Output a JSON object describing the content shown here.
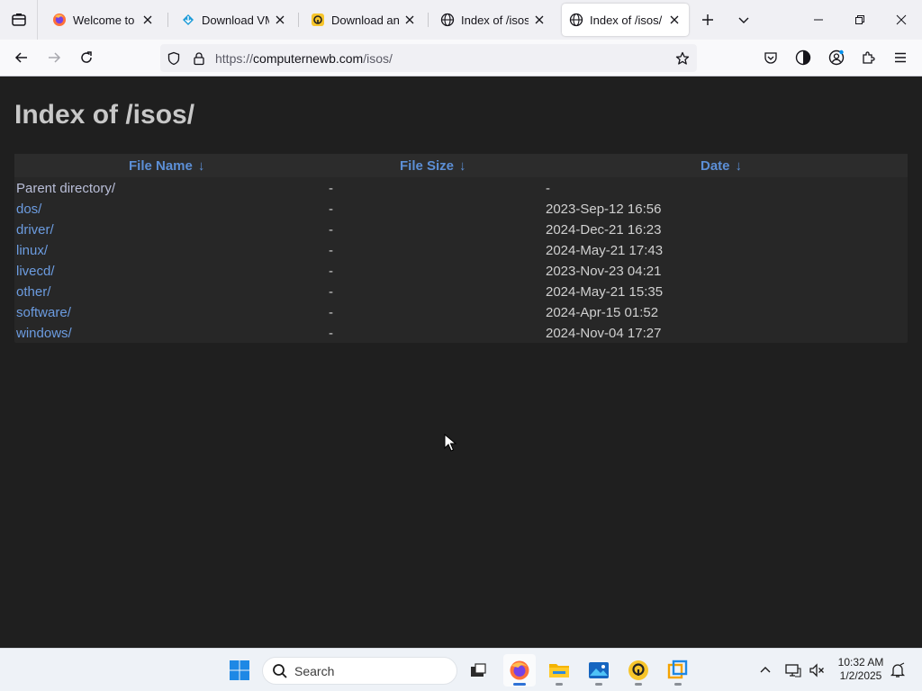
{
  "browser": {
    "tabs": [
      {
        "label": "Welcome to Firefox",
        "favicon": "firefox-icon",
        "active": false
      },
      {
        "label": "Download VMware",
        "favicon": "vmware-download-icon",
        "active": false
      },
      {
        "label": "Download and Install",
        "favicon": "app-yellow-icon",
        "active": false
      },
      {
        "label": "Index of /isos/w",
        "favicon": "globe-icon",
        "active": false
      },
      {
        "label": "Index of /isos/",
        "favicon": "globe-icon",
        "active": true
      }
    ],
    "url": {
      "scheme": "https://",
      "host": "computernewb.com",
      "path": "/isos/"
    }
  },
  "page": {
    "title": "Index of /isos/",
    "columns": {
      "name": "File Name",
      "size": "File Size",
      "date": "Date",
      "sort_arrow": "↓"
    },
    "rows": [
      {
        "name": "Parent directory/",
        "size": "-",
        "date": "-"
      },
      {
        "name": "dos/",
        "size": "-",
        "date": "2023-Sep-12 16:56"
      },
      {
        "name": "driver/",
        "size": "-",
        "date": "2024-Dec-21 16:23"
      },
      {
        "name": "linux/",
        "size": "-",
        "date": "2024-May-21 17:43"
      },
      {
        "name": "livecd/",
        "size": "-",
        "date": "2023-Nov-23 04:21"
      },
      {
        "name": "other/",
        "size": "-",
        "date": "2024-May-21 15:35"
      },
      {
        "name": "software/",
        "size": "-",
        "date": "2024-Apr-15 01:52"
      },
      {
        "name": "windows/",
        "size": "-",
        "date": "2024-Nov-04 17:27"
      }
    ]
  },
  "taskbar": {
    "search_label": "Search",
    "time": "10:32 AM",
    "date": "1/2/2025"
  },
  "colors": {
    "page_bg": "#1f1f1f",
    "link": "#6c9ce0",
    "header_link": "#5c8fd6",
    "title": "#c8c8c8"
  }
}
